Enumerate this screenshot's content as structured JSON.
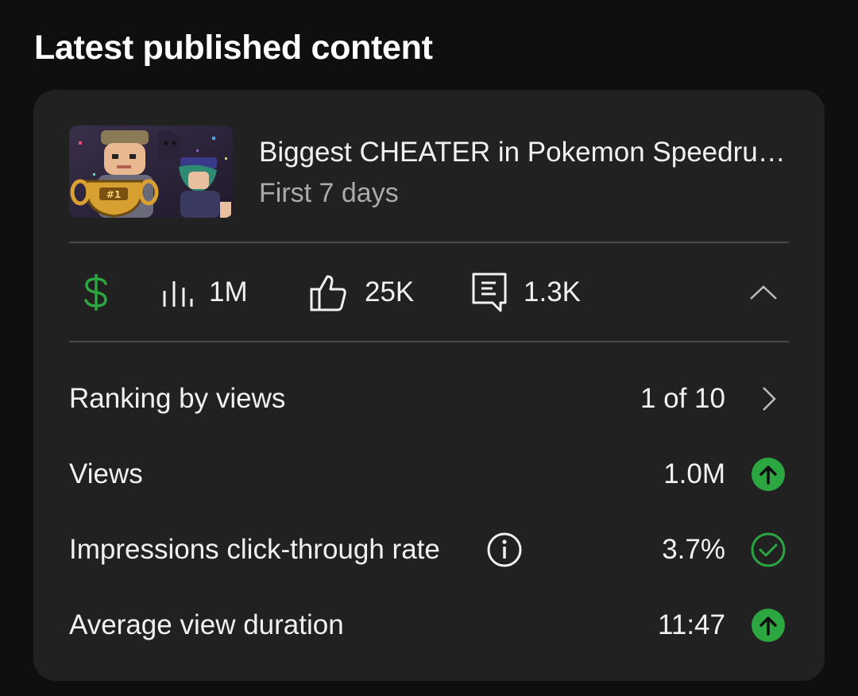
{
  "section": {
    "title": "Latest published content"
  },
  "video": {
    "title": "Biggest CHEATER in Pokemon Speedru…",
    "subtitle": "First 7 days",
    "thumbnail": {
      "badge": "#1"
    }
  },
  "stats": {
    "revenue_icon": "dollar-icon",
    "views": "1M",
    "likes": "25K",
    "comments": "1.3K",
    "collapse_icon": "chevron-up-icon"
  },
  "metrics": [
    {
      "label": "Ranking by views",
      "value": "1 of 10",
      "icon": "chevron-right-icon"
    },
    {
      "label": "Views",
      "value": "1.0M",
      "icon": "arrow-up-circle-icon"
    },
    {
      "label": "Impressions click-through rate",
      "value": "3.7%",
      "icon": "check-circle-icon"
    },
    {
      "label": "Average view duration",
      "value": "11:47",
      "icon": "arrow-up-circle-icon"
    }
  ],
  "colors": {
    "background": "#0f0f0f",
    "card": "#212121",
    "accent_green": "#2ba640",
    "secondary_text": "#aaaaaa"
  }
}
